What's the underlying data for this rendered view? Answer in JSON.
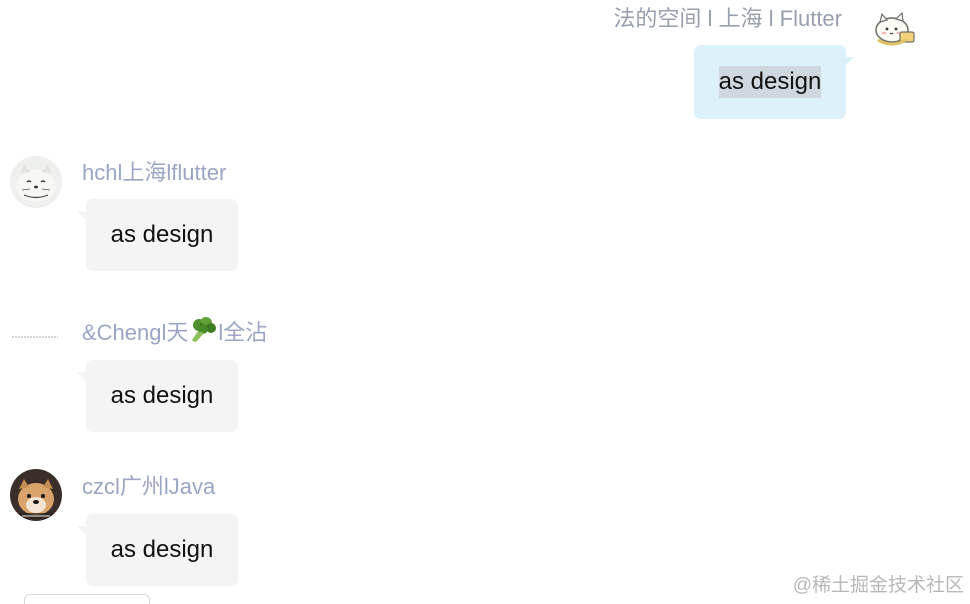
{
  "self_message": {
    "sender": "法的空间 l 上海 l Flutter",
    "text": "as design"
  },
  "messages": [
    {
      "sender": "hchl上海lflutter",
      "text": "as design",
      "avatar": "cat-avatar"
    },
    {
      "sender_prefix": "&Chengl天",
      "sender_emoji": "broccoli-icon",
      "sender_suffix": "l全沾",
      "text": "as design",
      "avatar": "blank-avatar"
    },
    {
      "sender": "czcl广州lJava",
      "text": "as design",
      "avatar": "dog-avatar"
    }
  ],
  "watermark": "@稀土掘金技术社区",
  "colors": {
    "self_bubble": "#ddf1fb",
    "other_bubble": "#f4f4f4",
    "sender_name": "#9aa6c4",
    "self_name": "#98a0ae"
  }
}
